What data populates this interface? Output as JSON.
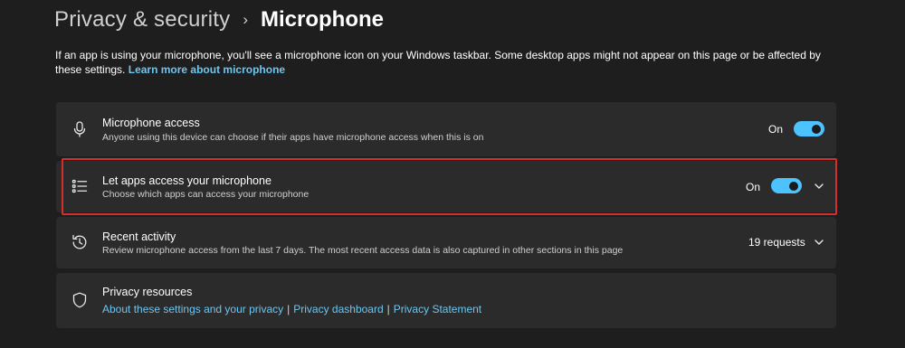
{
  "header": {
    "parent": "Privacy & security",
    "separator": "›",
    "current": "Microphone"
  },
  "description": {
    "text": "If an app is using your microphone, you'll see a microphone icon on your Windows taskbar. Some desktop apps might not appear on this page or be affected by these settings.",
    "link": "Learn more about microphone"
  },
  "settings": {
    "microphone_access": {
      "title": "Microphone access",
      "subtitle": "Anyone using this device can choose if their apps have microphone access when this is on",
      "state": "On",
      "icon": "microphone-icon"
    },
    "let_apps": {
      "title": "Let apps access your microphone",
      "subtitle": "Choose which apps can access your microphone",
      "state": "On",
      "icon": "list-icon"
    },
    "recent_activity": {
      "title": "Recent activity",
      "subtitle": "Review microphone access from the last 7 days. The most recent access data is also captured in other sections in this page",
      "count": "19 requests",
      "icon": "history-icon"
    },
    "privacy_resources": {
      "title": "Privacy resources",
      "icon": "shield-icon",
      "links": [
        "About these settings and your privacy",
        "Privacy dashboard",
        "Privacy Statement"
      ],
      "separator": "|"
    }
  },
  "colors": {
    "background": "#1e1e1e",
    "card": "#2b2b2b",
    "accent": "#4cc2ff",
    "link": "#6cc6f0",
    "highlight": "#d32f2f"
  }
}
